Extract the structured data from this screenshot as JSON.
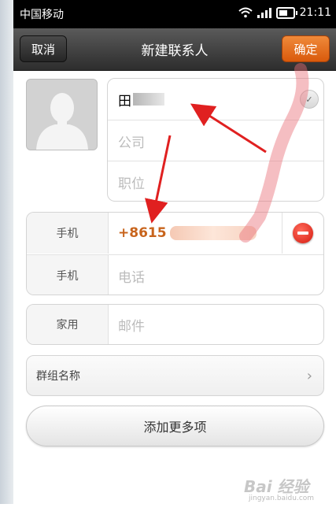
{
  "status_bar": {
    "carrier": "中国移动",
    "time": "21:11"
  },
  "header": {
    "cancel_label": "取消",
    "title": "新建联系人",
    "confirm_label": "确定"
  },
  "name_card": {
    "name_value": "田",
    "company_placeholder": "公司",
    "position_placeholder": "职位"
  },
  "phones": [
    {
      "type": "手机",
      "value": "+8615"
    },
    {
      "type": "手机",
      "placeholder": "电话"
    }
  ],
  "email": {
    "type": "家用",
    "placeholder": "邮件"
  },
  "group": {
    "label": "群组名称"
  },
  "add_more_label": "添加更多项",
  "watermark": {
    "logo": "Bai 经验",
    "url": "jingyan.baidu.com"
  },
  "colors": {
    "confirm": "#e8711f",
    "phone_text": "#c8641c",
    "remove": "#d51b10",
    "annotation": "#e02020"
  }
}
